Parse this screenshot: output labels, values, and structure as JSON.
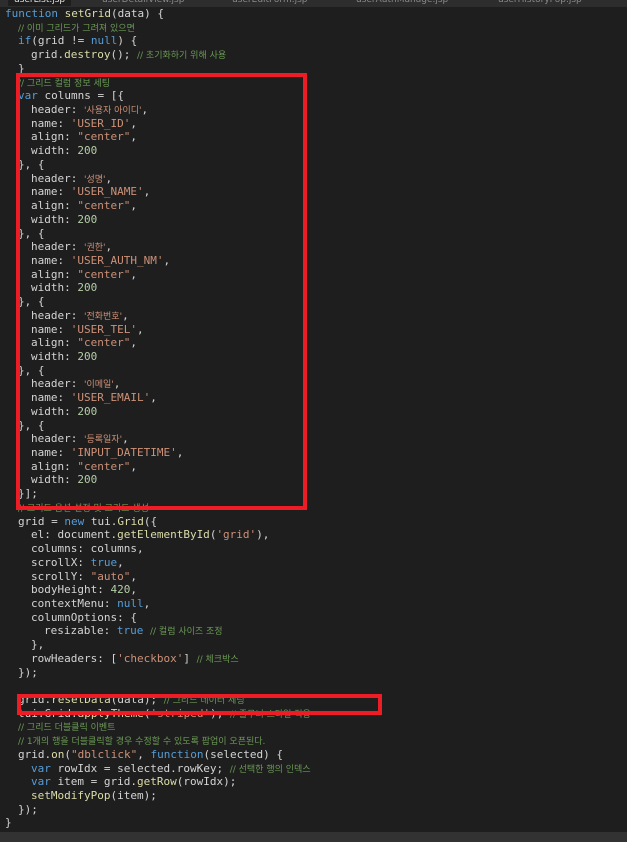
{
  "tabs": [
    "userList.jsp",
    "userDetailView.jsp",
    "userEditForm.jsp",
    "userAuthManage.jsp",
    "userHistoryPop.jsp"
  ],
  "editor": {
    "lines": [
      {
        "i": 0,
        "t": [
          [
            "kw",
            "function"
          ],
          [
            "p",
            " "
          ],
          [
            "fn",
            "setGrid"
          ],
          [
            "p",
            "(data) {"
          ]
        ]
      },
      {
        "i": 1,
        "t": [
          [
            "cmtko",
            "// 이미 그리드가 그려져 있으면"
          ]
        ]
      },
      {
        "i": 1,
        "t": [
          [
            "kw",
            "if"
          ],
          [
            "p",
            "(grid != "
          ],
          [
            "kw",
            "null"
          ],
          [
            "p",
            ") {"
          ]
        ]
      },
      {
        "i": 2,
        "t": [
          [
            "p",
            "grid."
          ],
          [
            "fn",
            "destroy"
          ],
          [
            "p",
            "(); "
          ],
          [
            "cmtko",
            "// 초기화하기 위해 사용"
          ]
        ]
      },
      {
        "i": 1,
        "t": [
          [
            "p",
            "}"
          ]
        ]
      },
      {
        "i": 1,
        "t": [
          [
            "cmtko",
            "// 그리드 컬럼 정보 세팅"
          ]
        ]
      },
      {
        "i": 1,
        "t": [
          [
            "kw",
            "var"
          ],
          [
            "p",
            " columns = [{"
          ]
        ]
      },
      {
        "i": 2,
        "t": [
          [
            "p",
            "header: "
          ],
          [
            "strko",
            "'사용자 아이디'"
          ],
          [
            "p",
            ","
          ]
        ]
      },
      {
        "i": 2,
        "t": [
          [
            "p",
            "name: "
          ],
          [
            "str",
            "'USER_ID'"
          ],
          [
            "p",
            ","
          ]
        ]
      },
      {
        "i": 2,
        "t": [
          [
            "p",
            "align: "
          ],
          [
            "str",
            "\"center\""
          ],
          [
            "p",
            ","
          ]
        ]
      },
      {
        "i": 2,
        "t": [
          [
            "p",
            "width: "
          ],
          [
            "num",
            "200"
          ]
        ]
      },
      {
        "i": 1,
        "t": [
          [
            "p",
            "}, {"
          ]
        ]
      },
      {
        "i": 2,
        "t": [
          [
            "p",
            "header: "
          ],
          [
            "strko",
            "'성명'"
          ],
          [
            "p",
            ","
          ]
        ]
      },
      {
        "i": 2,
        "t": [
          [
            "p",
            "name: "
          ],
          [
            "str",
            "'USER_NAME'"
          ],
          [
            "p",
            ","
          ]
        ]
      },
      {
        "i": 2,
        "t": [
          [
            "p",
            "align: "
          ],
          [
            "str",
            "\"center\""
          ],
          [
            "p",
            ","
          ]
        ]
      },
      {
        "i": 2,
        "t": [
          [
            "p",
            "width: "
          ],
          [
            "num",
            "200"
          ]
        ]
      },
      {
        "i": 1,
        "t": [
          [
            "p",
            "}, {"
          ]
        ]
      },
      {
        "i": 2,
        "t": [
          [
            "p",
            "header: "
          ],
          [
            "strko",
            "'권한'"
          ],
          [
            "p",
            ","
          ]
        ]
      },
      {
        "i": 2,
        "t": [
          [
            "p",
            "name: "
          ],
          [
            "str",
            "'USER_AUTH_NM'"
          ],
          [
            "p",
            ","
          ]
        ]
      },
      {
        "i": 2,
        "t": [
          [
            "p",
            "align: "
          ],
          [
            "str",
            "\"center\""
          ],
          [
            "p",
            ","
          ]
        ]
      },
      {
        "i": 2,
        "t": [
          [
            "p",
            "width: "
          ],
          [
            "num",
            "200"
          ]
        ]
      },
      {
        "i": 1,
        "t": [
          [
            "p",
            "}, {"
          ]
        ]
      },
      {
        "i": 2,
        "t": [
          [
            "p",
            "header: "
          ],
          [
            "strko",
            "'전화번호'"
          ],
          [
            "p",
            ","
          ]
        ]
      },
      {
        "i": 2,
        "t": [
          [
            "p",
            "name: "
          ],
          [
            "str",
            "'USER_TEL'"
          ],
          [
            "p",
            ","
          ]
        ]
      },
      {
        "i": 2,
        "t": [
          [
            "p",
            "align: "
          ],
          [
            "str",
            "\"center\""
          ],
          [
            "p",
            ","
          ]
        ]
      },
      {
        "i": 2,
        "t": [
          [
            "p",
            "width: "
          ],
          [
            "num",
            "200"
          ]
        ]
      },
      {
        "i": 1,
        "t": [
          [
            "p",
            "}, {"
          ]
        ]
      },
      {
        "i": 2,
        "t": [
          [
            "p",
            "header: "
          ],
          [
            "strko",
            "'이메일'"
          ],
          [
            "p",
            ","
          ]
        ]
      },
      {
        "i": 2,
        "t": [
          [
            "p",
            "name: "
          ],
          [
            "str",
            "'USER_EMAIL'"
          ],
          [
            "p",
            ","
          ]
        ]
      },
      {
        "i": 2,
        "t": [
          [
            "p",
            "width: "
          ],
          [
            "num",
            "200"
          ]
        ]
      },
      {
        "i": 1,
        "t": [
          [
            "p",
            "}, {"
          ]
        ]
      },
      {
        "i": 2,
        "t": [
          [
            "p",
            "header: "
          ],
          [
            "strko",
            "'등록일자'"
          ],
          [
            "p",
            ","
          ]
        ]
      },
      {
        "i": 2,
        "t": [
          [
            "p",
            "name: "
          ],
          [
            "str",
            "'INPUT_DATETIME'"
          ],
          [
            "p",
            ","
          ]
        ]
      },
      {
        "i": 2,
        "t": [
          [
            "p",
            "align: "
          ],
          [
            "str",
            "\"center\""
          ],
          [
            "p",
            ","
          ]
        ]
      },
      {
        "i": 2,
        "t": [
          [
            "p",
            "width: "
          ],
          [
            "num",
            "200"
          ]
        ]
      },
      {
        "i": 1,
        "t": [
          [
            "p",
            "}];"
          ]
        ]
      },
      {
        "i": 1,
        "t": [
          [
            "cmtko",
            "// 그리드 옵션 설정 및 그리드 생성"
          ]
        ]
      },
      {
        "i": 1,
        "t": [
          [
            "p",
            "grid = "
          ],
          [
            "kw",
            "new"
          ],
          [
            "p",
            " tui."
          ],
          [
            "fn",
            "Grid"
          ],
          [
            "p",
            "({"
          ]
        ]
      },
      {
        "i": 2,
        "t": [
          [
            "p",
            "el: document."
          ],
          [
            "fn",
            "getElementById"
          ],
          [
            "p",
            "("
          ],
          [
            "str",
            "'grid'"
          ],
          [
            "p",
            "),"
          ]
        ]
      },
      {
        "i": 2,
        "t": [
          [
            "p",
            "columns: columns,"
          ]
        ]
      },
      {
        "i": 2,
        "t": [
          [
            "p",
            "scrollX: "
          ],
          [
            "kw",
            "true"
          ],
          [
            "p",
            ","
          ]
        ]
      },
      {
        "i": 2,
        "t": [
          [
            "p",
            "scrollY: "
          ],
          [
            "str",
            "\"auto\""
          ],
          [
            "p",
            ","
          ]
        ]
      },
      {
        "i": 2,
        "t": [
          [
            "p",
            "bodyHeight: "
          ],
          [
            "num",
            "420"
          ],
          [
            "p",
            ","
          ]
        ]
      },
      {
        "i": 2,
        "t": [
          [
            "p",
            "contextMenu: "
          ],
          [
            "kw",
            "null"
          ],
          [
            "p",
            ","
          ]
        ]
      },
      {
        "i": 2,
        "t": [
          [
            "p",
            "columnOptions: {"
          ]
        ]
      },
      {
        "i": 3,
        "t": [
          [
            "p",
            "resizable: "
          ],
          [
            "kw",
            "true"
          ],
          [
            "p",
            " "
          ],
          [
            "cmtko",
            "// 컬럼 사이즈 조정"
          ]
        ]
      },
      {
        "i": 2,
        "t": [
          [
            "p",
            "},"
          ]
        ]
      },
      {
        "i": 2,
        "t": [
          [
            "p",
            "rowHeaders: ["
          ],
          [
            "str",
            "'checkbox'"
          ],
          [
            "p",
            "] "
          ],
          [
            "cmtko",
            "// 체크박스"
          ]
        ]
      },
      {
        "i": 1,
        "t": [
          [
            "p",
            "});"
          ]
        ]
      },
      {
        "i": 0,
        "t": []
      },
      {
        "i": 1,
        "t": [
          [
            "p",
            "grid."
          ],
          [
            "fn",
            "resetData"
          ],
          [
            "p",
            "(data); "
          ],
          [
            "cmtko",
            "// 그리드 데이터 세팅"
          ]
        ]
      },
      {
        "i": 1,
        "t": [
          [
            "p",
            "tui.Grid."
          ],
          [
            "fn",
            "applyTheme"
          ],
          [
            "p",
            "("
          ],
          [
            "str",
            "'striped'"
          ],
          [
            "p",
            "); "
          ],
          [
            "cmtko",
            "// 줄무늬 스타일 적용"
          ]
        ]
      },
      {
        "i": 1,
        "t": [
          [
            "cmtko",
            "// 그리드 더블클릭 이벤트"
          ]
        ]
      },
      {
        "i": 1,
        "t": [
          [
            "cmtko",
            "// 1개의 행을 더블클릭할 경우 수정할 수 있도록 팝업이 오픈된다."
          ]
        ]
      },
      {
        "i": 1,
        "t": [
          [
            "p",
            "grid."
          ],
          [
            "fn",
            "on"
          ],
          [
            "p",
            "("
          ],
          [
            "str",
            "\"dblclick\""
          ],
          [
            "p",
            ", "
          ],
          [
            "kw",
            "function"
          ],
          [
            "p",
            "(selected) {"
          ]
        ]
      },
      {
        "i": 2,
        "t": [
          [
            "kw",
            "var"
          ],
          [
            "p",
            " rowIdx = selected.rowKey; "
          ],
          [
            "cmtko",
            "// 선택한 행의 인덱스"
          ]
        ]
      },
      {
        "i": 2,
        "t": [
          [
            "kw",
            "var"
          ],
          [
            "p",
            " item = grid."
          ],
          [
            "fn",
            "getRow"
          ],
          [
            "p",
            "(rowIdx);"
          ]
        ]
      },
      {
        "i": 2,
        "t": [
          [
            "fn",
            "setModifyPop"
          ],
          [
            "p",
            "(item);"
          ]
        ]
      },
      {
        "i": 1,
        "t": [
          [
            "p",
            "});"
          ]
        ]
      },
      {
        "i": 0,
        "t": [
          [
            "p",
            "}"
          ]
        ]
      }
    ]
  },
  "colors": {
    "background": "#1e1e1e",
    "keyword": "#569cd6",
    "function": "#dcdcaa",
    "string": "#ce9178",
    "number": "#b5cea8",
    "comment": "#6a9955",
    "highlight_box": "#ee1c25"
  }
}
